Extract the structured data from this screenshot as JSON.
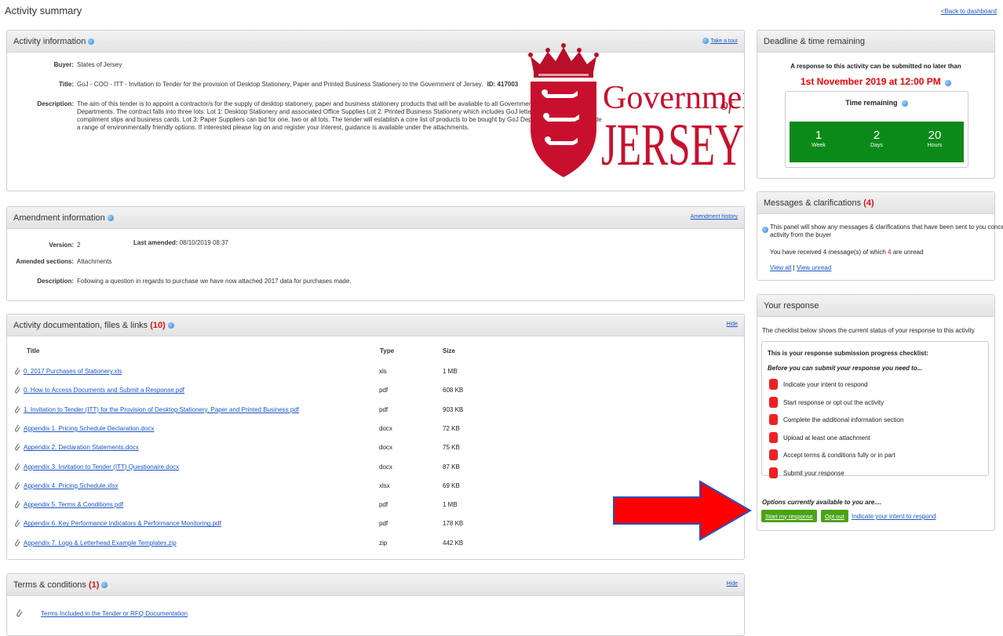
{
  "page": {
    "title": "Activity summary",
    "back_link": "<Back to dashboard"
  },
  "activity": {
    "title": "Activity information",
    "tour": "Take a tour",
    "buyer_label": "Buyer:",
    "buyer": "States of Jersey",
    "title_label": "Title:",
    "title_value": "GoJ - COO - ITT - Invitation to Tender for the provision of Desktop Stationery, Paper and Printed Business Stationery to the Government of Jersey.",
    "id_text": "ID: 417003",
    "description_label": "Description:",
    "description_lines": [
      "The aim of this tender is to appoint a contractor/s for the supply of desktop stationery, paper and business stationery products that will be available to all Government of Jersey (GoJ)",
      "Departments. The contract falls into three lots: Lot 1: Desktop Stationery and associated Office Supplies Lot 2: Printed Business Stationery which includes GoJ letter headed paper,",
      "compliment slips and business cards. Lot 3: Paper Suppliers can bid for one, two or all lots. The tender will establish a core list of products to be bought by GoJ Departments, this will include",
      "a range of environmentally friendly options. If interested please log on and register your interest, guidance is available under the attachments."
    ],
    "logo_line1": "Government",
    "logo_of": "of",
    "logo_line2": "JERSEY"
  },
  "amendment": {
    "title": "Amendment information",
    "history": "Amendment history",
    "version_label": "Version:",
    "version": "2",
    "last_amended_label": "Last amended:",
    "last_amended": "08/10/2019 08:37",
    "sections_label": "Amended sections:",
    "sections": "Attachments",
    "description_label": "Description:",
    "description": "Following a question in regards to purchase we have now attached 2017 data for purchases made."
  },
  "docs": {
    "title": "Activity documentation, files & links",
    "count": "(10)",
    "hide": "Hide",
    "col_title": "Title",
    "col_type": "Type",
    "col_size": "Size",
    "rows": [
      {
        "name": "0. 2017 Purchases of Stationery.xls",
        "type": "xls",
        "size": "1 MB"
      },
      {
        "name": "0. How to Access Documents and Submit a Response.pdf",
        "type": "pdf",
        "size": "608 KB"
      },
      {
        "name": "1. Invitation to Tender (ITT) for the Provision of Desktop Stationery, Paper and Printed Business.pdf",
        "type": "pdf",
        "size": "903 KB"
      },
      {
        "name": "Appendix 1. Pricing Schedule Declaration.docx",
        "type": "docx",
        "size": "72 KB"
      },
      {
        "name": "Appendix 2. Declaration Statements.docx",
        "type": "docx",
        "size": "75 KB"
      },
      {
        "name": "Appendix 3. Invitation to Tender (ITT) Questionaire.docx",
        "type": "docx",
        "size": "87 KB"
      },
      {
        "name": "Appendix 4. Pricing Schedule.xlsx",
        "type": "xlsx",
        "size": "69 KB"
      },
      {
        "name": "Appendix 5. Terms & Conditions.pdf",
        "type": "pdf",
        "size": "1 MB"
      },
      {
        "name": "Appendix 6. Key Performance Indicators & Performance Monitoring.pdf",
        "type": "pdf",
        "size": "178 KB"
      },
      {
        "name": "Appendix 7. Logo & Letterhead Example Templates.zip",
        "type": "zip",
        "size": "442 KB"
      }
    ]
  },
  "terms": {
    "title": "Terms & conditions",
    "count": "(1)",
    "hide": "Hide",
    "item": "Terms Included in the Tender or RFQ Documentation"
  },
  "deadline": {
    "title": "Deadline & time remaining",
    "intro": "A response to this activity can be submitted no later than",
    "date": "1st November 2019 at 12:00 PM",
    "remaining_title": "Time remaining",
    "units": [
      {
        "num": "1",
        "label": "Week"
      },
      {
        "num": "2",
        "label": "Days"
      },
      {
        "num": "20",
        "label": "Hours"
      }
    ]
  },
  "messages": {
    "title": "Messages & clarifications",
    "count": "(4)",
    "info_line1": "This panel will show any messages & clarifications that have been sent to you concerning this",
    "info_line2": "activity from the buyer",
    "received_pre": "You have received 4 message(s) of which",
    "unread_count": "4",
    "received_post": "are unread",
    "view_all": "View all",
    "separator": "|",
    "view_unread": "View unread"
  },
  "response": {
    "title": "Your response",
    "intro": "The checklist below shows the current status of your response to this activity",
    "checklist_title": "This is your response submission progress checklist:",
    "checklist_sub": "Before you can submit your response you need to...",
    "items": [
      "Indicate your intent to respond",
      "Start response or opt out the activity",
      "Complete the additional information section",
      "Upload at least one attachment",
      "Accept terms & conditions fully or in part",
      "Submit your response"
    ],
    "options_title": "Options currently available to you are....",
    "start_btn": "Start my response",
    "optout_btn": "Opt out",
    "intent_link": "Indicate your intent to respond"
  }
}
